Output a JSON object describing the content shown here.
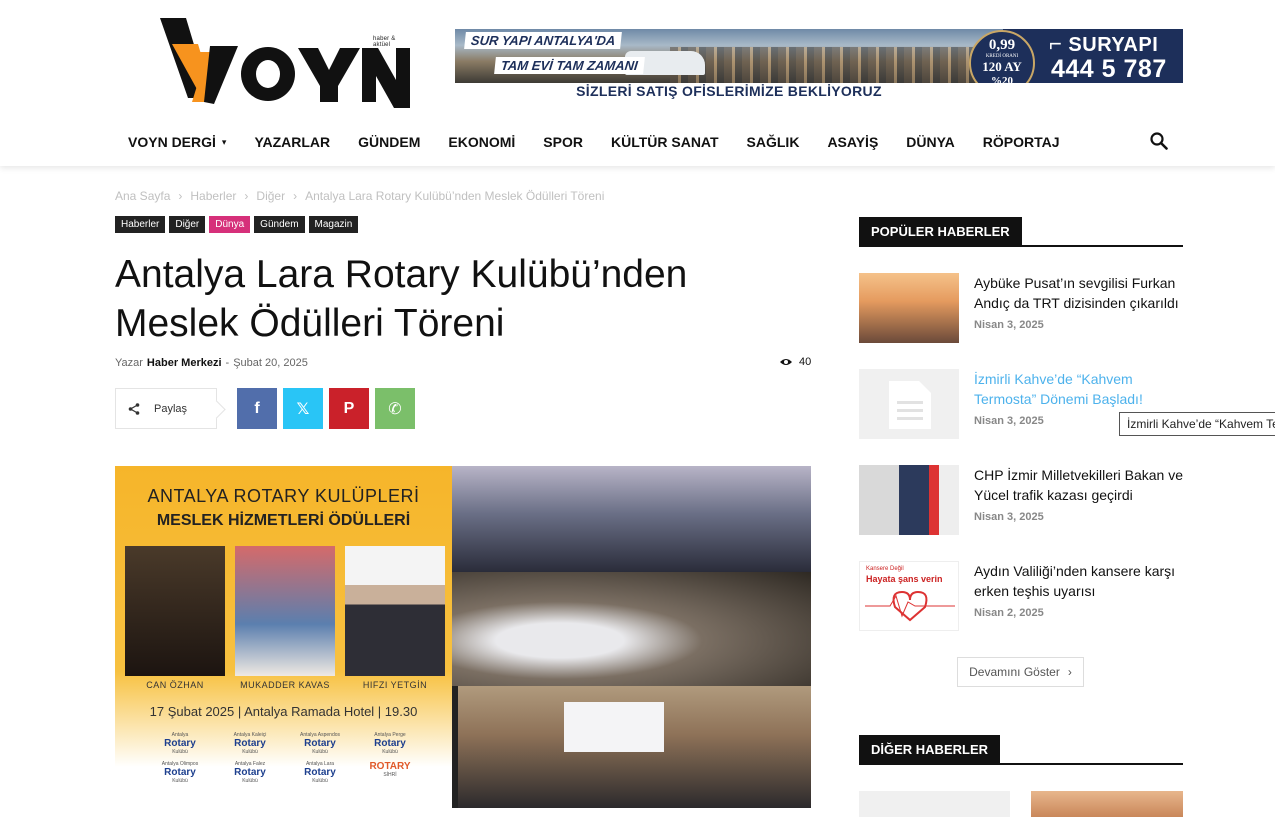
{
  "header": {
    "logo_text": "VOYN",
    "logo_tagline": "haber & aktüel",
    "banner": {
      "slogan1": "SUR YAPI ANTALYA'DA",
      "slogan2": "TAM EVİ TAM ZAMANI",
      "subtitle": "SİZLERİ SATIŞ OFİSLERİMİZE BEKLİYORUZ",
      "rate": "0,99",
      "rate_note": "KREDİ ORANI",
      "term": "120 AY",
      "down_payment": "%20",
      "brand": "SURYAPI",
      "phone": "444 5 787"
    },
    "colors": {
      "logo_orange": "#f7931e",
      "banner_navy": "#1d2f5a",
      "link_blue": "#4db2ec",
      "tag_pink": "#d6307a"
    }
  },
  "nav": {
    "items": [
      "VOYN DERGİ",
      "YAZARLAR",
      "GÜNDEM",
      "EKONOMİ",
      "SPOR",
      "KÜLTÜR SANAT",
      "SAĞLIK",
      "ASAYİŞ",
      "DÜNYA",
      "RÖPORTAJ"
    ],
    "dropdown_icon": "chevron-down-icon",
    "search_icon": "search-icon"
  },
  "article": {
    "breadcrumb": [
      "Ana Sayfa",
      "Haberler",
      "Diğer",
      "Antalya Lara Rotary Kulübü’nden Meslek Ödülleri Töreni"
    ],
    "tags": [
      "Haberler",
      "Diğer",
      "Dünya",
      "Gündem",
      "Magazin"
    ],
    "title": "Antalya Lara Rotary Kulübü’nden Meslek Ödülleri Töreni",
    "author_prefix": "Yazar",
    "author": "Haber Merkezi",
    "meta_sep": "-",
    "date": "Şubat 20, 2025",
    "views": "40",
    "share_label": "Paylaş",
    "share_buttons": [
      {
        "name": "facebook",
        "glyph": "f",
        "color": "#516eab"
      },
      {
        "name": "x",
        "glyph": "𝕏",
        "color": "#29c5f6"
      },
      {
        "name": "pinterest",
        "glyph": "P",
        "color": "#ca212a"
      },
      {
        "name": "whatsapp",
        "glyph": "✆",
        "color": "#7bbf6a"
      }
    ],
    "hero": {
      "heading1": "ANTALYA ROTARY KULÜPLERİ",
      "heading2": "MESLEK HİZMETLERİ ÖDÜLLERİ",
      "people": [
        "CAN ÖZHAN",
        "MUKADDER KAVAS",
        "HIFZI YETGİN"
      ],
      "event": "17 Şubat 2025 | Antalya Ramada Hotel | 19.30",
      "clubs": [
        {
          "top": "Antalya",
          "main": "Rotary",
          "sub": "Kulübü"
        },
        {
          "top": "Antalya Kaleiçi",
          "main": "Rotary",
          "sub": "Kulübü"
        },
        {
          "top": "Antalya Aspendos",
          "main": "Rotary",
          "sub": "Kulübü"
        },
        {
          "top": "Antalya Perge",
          "main": "Rotary",
          "sub": "Kulübü"
        },
        {
          "top": "Antalya Olimpos",
          "main": "Rotary",
          "sub": "Kulübü"
        },
        {
          "top": "Antalya Falez",
          "main": "Rotary",
          "sub": "Kulübü"
        },
        {
          "top": "Antalya Lara",
          "main": "Rotary",
          "sub": "Kulübü"
        },
        {
          "top": "",
          "main": "ROTARY",
          "sub": "SİHRİ"
        }
      ]
    }
  },
  "sidebar": {
    "popular_title": "POPÜLER HABERLER",
    "popular": [
      {
        "title": "Aybüke Pusat’ın sevgilisi Furkan Andıç da TRT dizisinden çıkarıldı",
        "date": "Nisan 3, 2025",
        "highlight": false
      },
      {
        "title": "İzmirli Kahve’de “Kahvem Termosta” Dönemi Başladı!",
        "date": "Nisan 3, 2025",
        "highlight": true
      },
      {
        "title": "CHP İzmir Milletvekilleri Bakan ve Yücel trafik kazası geçirdi",
        "date": "Nisan 3, 2025",
        "highlight": false
      },
      {
        "title": "Aydın Valiliği’nden kansere karşı erken teşhis uyarısı",
        "date": "Nisan 2, 2025",
        "highlight": false
      }
    ],
    "thumb4_text": [
      "Kansere Değil",
      "Hayata şans verin"
    ],
    "tooltip": "İzmirli Kahve’de “Kahvem Termosta” Dönemi Başladı!",
    "more_label": "Devamını Göster",
    "more_icon": "chevron-right-icon",
    "other_title": "DİĞER HABERLER"
  }
}
